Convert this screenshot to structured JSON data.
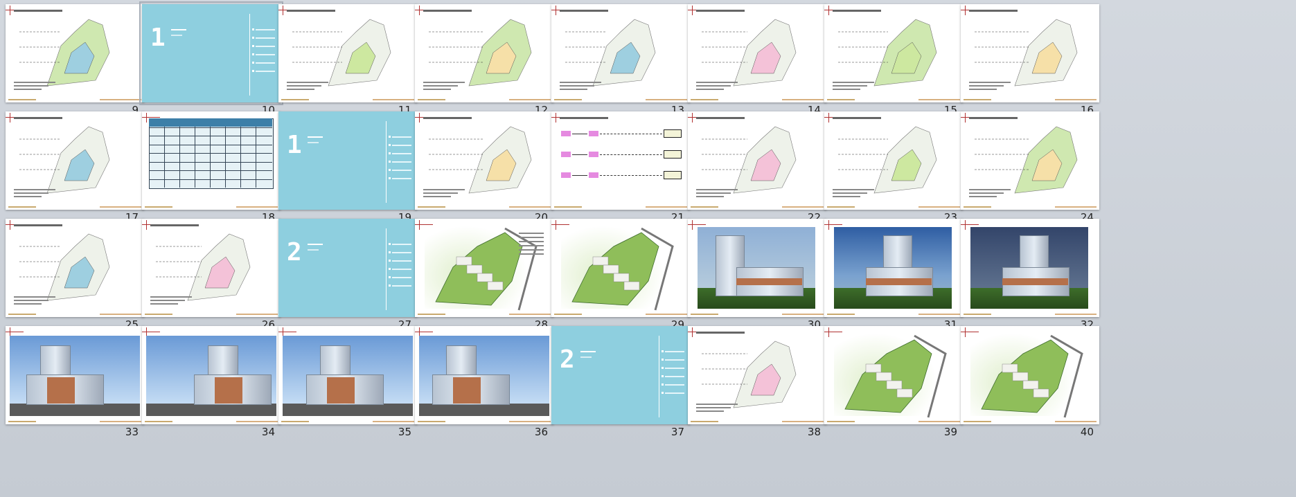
{
  "slides": [
    {
      "n": "9",
      "type": "plan"
    },
    {
      "n": "10",
      "type": "section",
      "digit": "1",
      "selected": true
    },
    {
      "n": "11",
      "type": "plan"
    },
    {
      "n": "12",
      "type": "plan"
    },
    {
      "n": "13",
      "type": "plan"
    },
    {
      "n": "14",
      "type": "plan"
    },
    {
      "n": "15",
      "type": "plan"
    },
    {
      "n": "16",
      "type": "plan"
    },
    {
      "n": "17",
      "type": "plan"
    },
    {
      "n": "18",
      "type": "table"
    },
    {
      "n": "19",
      "type": "section",
      "digit": "1"
    },
    {
      "n": "20",
      "type": "plan"
    },
    {
      "n": "21",
      "type": "diagram"
    },
    {
      "n": "22",
      "type": "plan"
    },
    {
      "n": "23",
      "type": "plan"
    },
    {
      "n": "24",
      "type": "plan"
    },
    {
      "n": "25",
      "type": "plan"
    },
    {
      "n": "26",
      "type": "plan"
    },
    {
      "n": "27",
      "type": "section",
      "digit": "2"
    },
    {
      "n": "28",
      "type": "render"
    },
    {
      "n": "29",
      "type": "render"
    },
    {
      "n": "30",
      "type": "photo"
    },
    {
      "n": "31",
      "type": "photo"
    },
    {
      "n": "32",
      "type": "photo"
    },
    {
      "n": "33",
      "type": "elevation"
    },
    {
      "n": "34",
      "type": "elevation"
    },
    {
      "n": "35",
      "type": "elevation"
    },
    {
      "n": "36",
      "type": "elevation"
    },
    {
      "n": "37",
      "type": "section",
      "digit": "2"
    },
    {
      "n": "38",
      "type": "plan"
    },
    {
      "n": "39",
      "type": "render"
    },
    {
      "n": "40",
      "type": "render"
    }
  ],
  "colors": {
    "section_blue": "#8ecfdf",
    "background": "#cdd2d9"
  }
}
